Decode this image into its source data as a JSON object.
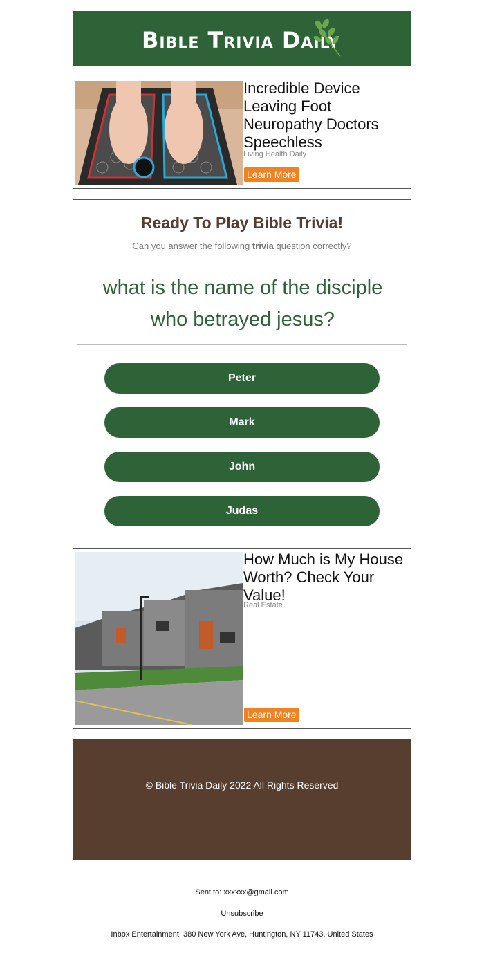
{
  "header": {
    "logo_text": "Bible Trivia Daily",
    "brand_color": "#2d6337",
    "icon": "leaf-icon"
  },
  "ad_top": {
    "title": "Incredible Device Leaving Foot Neuropathy Doctors Speechless",
    "source": "Living Health Daily",
    "button_label": "Learn More",
    "image": "foot-massager-photo"
  },
  "trivia": {
    "title": "Ready To Play Bible Trivia!",
    "subtitle_pre": "Can you answer the following ",
    "subtitle_bold": "trivia",
    "subtitle_post": " question correctly?",
    "question": "what is the name of the disciple who betrayed jesus?",
    "answers": [
      "Peter",
      "Mark",
      "John",
      "Judas"
    ]
  },
  "ad_bottom": {
    "title": "How Much is My House Worth? Check Your Value!",
    "source": "Real Estate",
    "button_label": "Learn More",
    "image": "townhouses-photo"
  },
  "footer": {
    "copyright": "© Bible Trivia Daily 2022 All Rights Reserved",
    "color": "#573e2f"
  },
  "meta_lines": {
    "sent_to": "Sent to: xxxxxx@gmail.com",
    "unsubscribe": "Unsubscribe",
    "address": "Inbox Entertainment, 380 New York Ave, Huntington, NY 11743, United States"
  },
  "accent_color": "#f08222"
}
